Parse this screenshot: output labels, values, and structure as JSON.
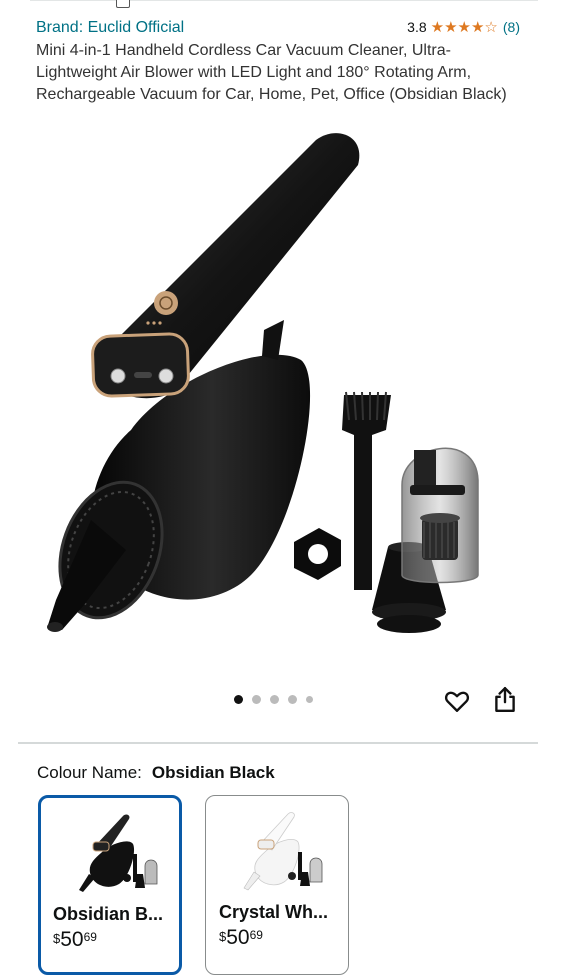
{
  "brand": {
    "text": "Brand: Euclid Official"
  },
  "rating": {
    "value": "3.8",
    "stars": "★★★★☆",
    "count": "(8)"
  },
  "product": {
    "title": "Mini 4-in-1 Handheld Cordless Car Vacuum Cleaner, Ultra-Lightweight Air Blower with LED Light and 180° Rotating Arm, Rechargeable Vacuum for Car, Home, Pet, Office (Obsidian Black)"
  },
  "gallery": {
    "image_count": 5,
    "active_index": 0,
    "image_icon": "vacuum-product-photo"
  },
  "actions": {
    "favorite_icon": "heart-icon",
    "share_icon": "share-icon"
  },
  "colour": {
    "label": "Colour Name:",
    "selected": "Obsidian Black"
  },
  "variants": [
    {
      "name": "Obsidian B...",
      "currency": "$",
      "whole": "50",
      "fraction": "69",
      "selected": true,
      "swatch": "#1a1a1a"
    },
    {
      "name": "Crystal Wh...",
      "currency": "$",
      "whole": "50",
      "fraction": "69",
      "selected": false,
      "swatch": "#f2f2f2"
    }
  ],
  "colors": {
    "link": "#007185",
    "star": "#de7921",
    "selected_border": "#0a5aa7"
  }
}
